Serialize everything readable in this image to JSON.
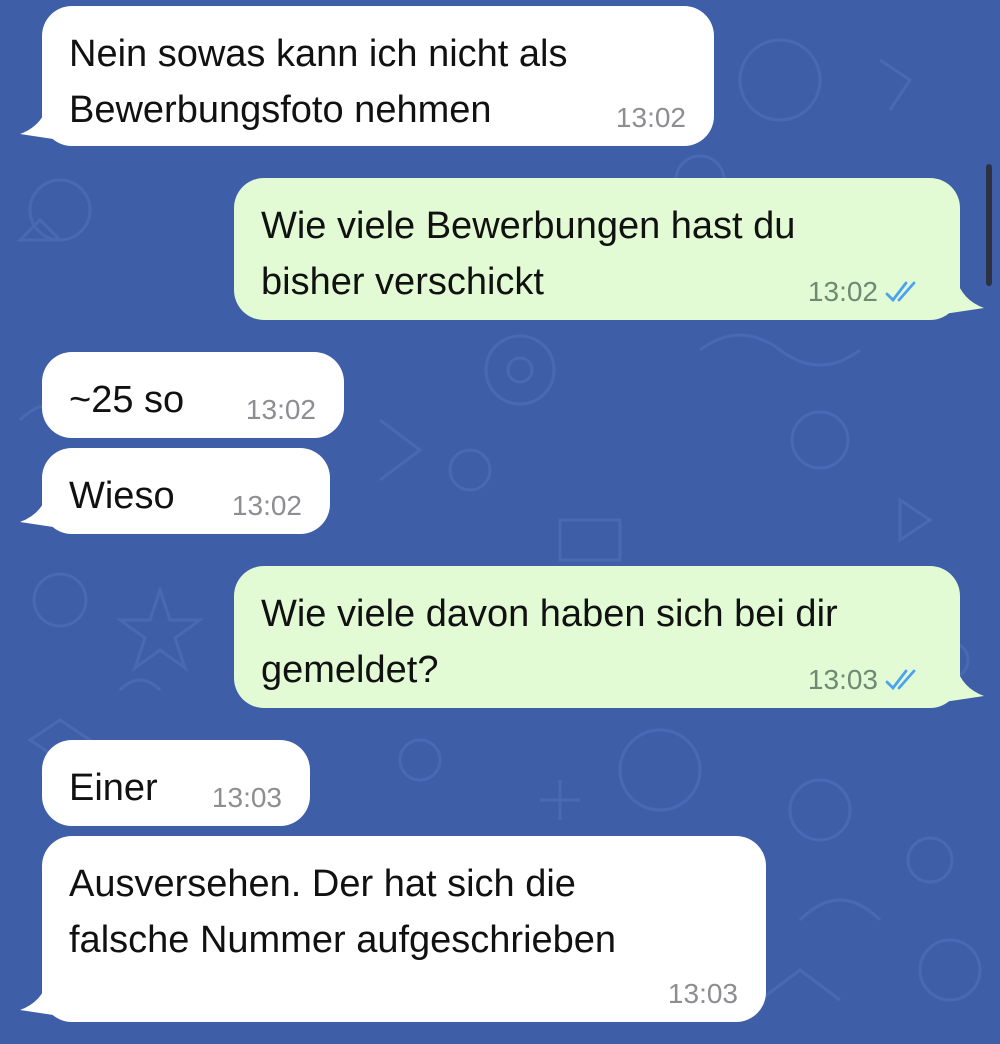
{
  "colors": {
    "background": "#3f5ea8",
    "incoming_bubble": "#ffffff",
    "outgoing_bubble": "#e2fbd5",
    "timestamp_incoming": "#8d8d92",
    "timestamp_outgoing": "#6e8a73",
    "read_ticks": "#4aa3f0"
  },
  "messages": [
    {
      "direction": "incoming",
      "text": "Nein sowas kann ich nicht als\nBewerbungsfoto nehmen",
      "time": "13:02"
    },
    {
      "direction": "outgoing",
      "text": "Wie viele Bewerbungen hast du\nbisher verschickt",
      "time": "13:02",
      "status_icon": "double-check-read-icon"
    },
    {
      "direction": "incoming",
      "text": "~25 so",
      "time": "13:02"
    },
    {
      "direction": "incoming",
      "text": "Wieso",
      "time": "13:02"
    },
    {
      "direction": "outgoing",
      "text": "Wie viele davon haben sich bei dir\ngemeldet?",
      "time": "13:03",
      "status_icon": "double-check-read-icon"
    },
    {
      "direction": "incoming",
      "text": "Einer",
      "time": "13:03"
    },
    {
      "direction": "incoming",
      "text": "Ausversehen. Der hat sich die\nfalsche Nummer aufgeschrieben",
      "time": "13:03"
    }
  ]
}
